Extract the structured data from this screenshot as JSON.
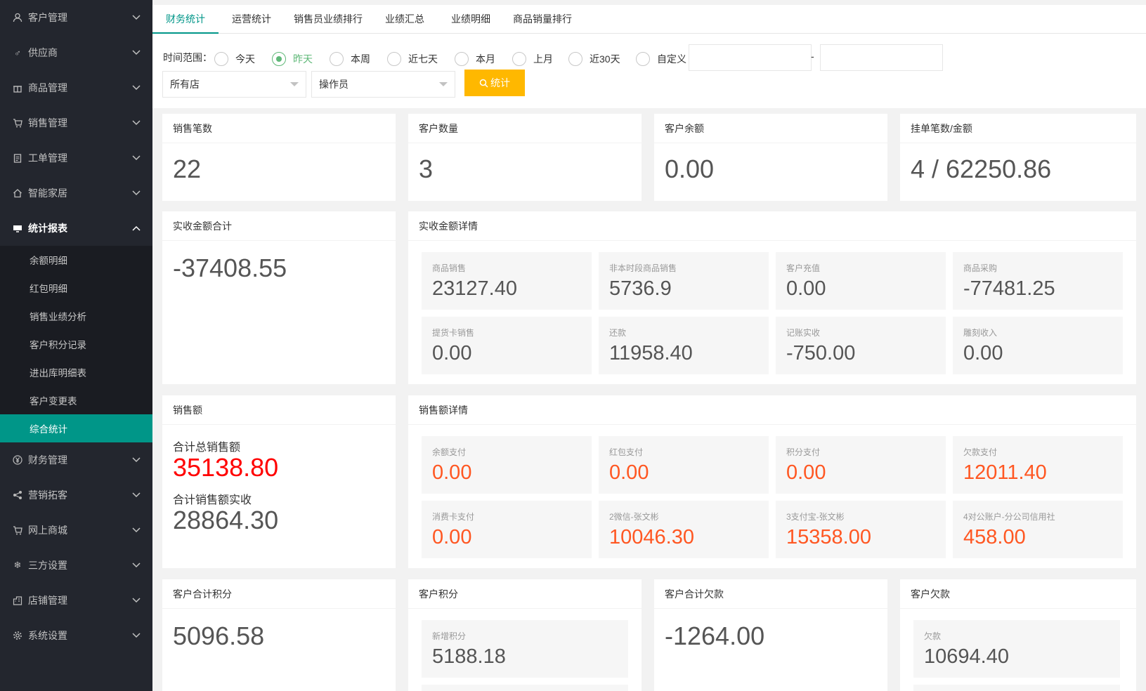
{
  "sidebar": {
    "menu_top": [
      {
        "label": "客户管理",
        "icon": "user-icon"
      },
      {
        "label": "供应商",
        "icon": "male-icon"
      },
      {
        "label": "商品管理",
        "icon": "gift-icon"
      },
      {
        "label": "销售管理",
        "icon": "cart-icon"
      },
      {
        "label": "工单管理",
        "icon": "clipboard-icon"
      },
      {
        "label": "智能家居",
        "icon": "home-icon"
      }
    ],
    "open_menu": {
      "label": "统计报表",
      "icon": "report-icon"
    },
    "sub_items": [
      "余额明细",
      "红包明细",
      "销售业绩分析",
      "客户积分记录",
      "进出库明细表",
      "客户变更表",
      "综合统计"
    ],
    "active_sub": "综合统计",
    "menu_bottom": [
      {
        "label": "财务管理",
        "icon": "yen-icon"
      },
      {
        "label": "营销拓客",
        "icon": "share-icon"
      },
      {
        "label": "网上商城",
        "icon": "cart-icon"
      },
      {
        "label": "三方设置",
        "icon": "snowflake-icon"
      },
      {
        "label": "店铺管理",
        "icon": "building-icon"
      },
      {
        "label": "系统设置",
        "icon": "gear-icon"
      }
    ]
  },
  "tabs": [
    "财务统计",
    "运营统计",
    "销售员业绩排行",
    "业绩汇总",
    "业绩明细",
    "商品销量排行"
  ],
  "active_tab": "财务统计",
  "filter": {
    "time_label": "时间范围：",
    "options": [
      "今天",
      "昨天",
      "本周",
      "近七天",
      "本月",
      "上月",
      "近30天",
      "自定义"
    ],
    "selected": "昨天",
    "date_from": "",
    "date_to": "",
    "date_separator": "-",
    "store_select": "所有店",
    "operator_select": "操作员",
    "stat_button": "统计"
  },
  "row1": [
    {
      "title": "销售笔数",
      "value": "22"
    },
    {
      "title": "客户数量",
      "value": "3"
    },
    {
      "title": "客户余额",
      "value": "0.00"
    },
    {
      "title": "挂单笔数/金额",
      "value": "4 / 62250.86"
    }
  ],
  "received_total": {
    "title": "实收金额合计",
    "value": "-37408.55"
  },
  "received_detail": {
    "title": "实收金额详情",
    "tiles": [
      {
        "label": "商品销售",
        "value": "23127.40"
      },
      {
        "label": "非本时段商品销售",
        "value": "5736.9"
      },
      {
        "label": "客户充值",
        "value": "0.00"
      },
      {
        "label": "商品采购",
        "value": "-77481.25"
      },
      {
        "label": "提货卡销售",
        "value": "0.00"
      },
      {
        "label": "还款",
        "value": "11958.40"
      },
      {
        "label": "记账实收",
        "value": "-750.00"
      },
      {
        "label": "雕刻收入",
        "value": "0.00"
      }
    ]
  },
  "sales": {
    "title": "销售额",
    "total_label": "合计总销售额",
    "total_value": "35138.80",
    "received_label": "合计销售额实收",
    "received_value": "28864.30"
  },
  "sales_detail": {
    "title": "销售额详情",
    "tiles": [
      {
        "label": "余额支付",
        "value": "0.00"
      },
      {
        "label": "红包支付",
        "value": "0.00"
      },
      {
        "label": "积分支付",
        "value": "0.00"
      },
      {
        "label": "欠款支付",
        "value": "12011.40"
      },
      {
        "label": "消费卡支付",
        "value": "0.00"
      },
      {
        "label": "2微信-张文彬",
        "value": "10046.30"
      },
      {
        "label": "3支付宝-张文彬",
        "value": "15358.00"
      },
      {
        "label": "4对公账户-分公司信用社",
        "value": "458.00"
      }
    ]
  },
  "customer_points_total": {
    "title": "客户合计积分",
    "value": "5096.58"
  },
  "customer_points": {
    "title": "客户积分",
    "tile_label": "新增积分",
    "tile_value": "5188.18"
  },
  "customer_debt_total": {
    "title": "客户合计欠款",
    "value": "-1264.00"
  },
  "customer_debt": {
    "title": "客户欠款",
    "tile_label": "欠款",
    "tile_value": "10694.40"
  },
  "colors": {
    "sidebar_bg": "#23262e",
    "accent": "#009688",
    "radio_green": "#5fb878",
    "button_yellow": "#ffb800",
    "orange_value": "#ff5722",
    "red_value": "#ff0000"
  }
}
